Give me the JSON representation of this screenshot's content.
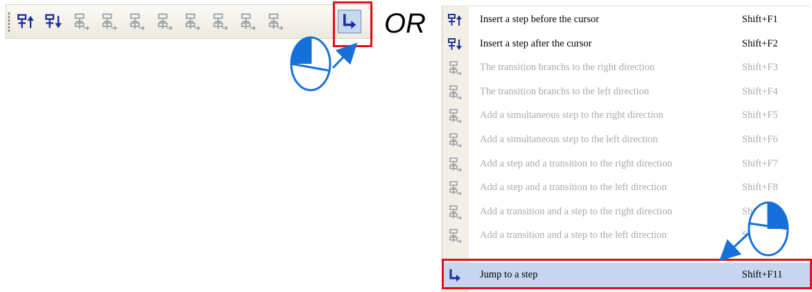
{
  "separator_text": "OR",
  "toolbar": {
    "buttons": [
      {
        "name": "insert-step-before-button",
        "icon": "step-insert-before-icon",
        "enabled": true
      },
      {
        "name": "insert-step-after-button",
        "icon": "step-insert-after-icon",
        "enabled": true
      },
      {
        "name": "transition-branch-right-button",
        "icon": "branch-right-icon",
        "enabled": false
      },
      {
        "name": "transition-branch-left-button",
        "icon": "branch-left-icon",
        "enabled": false
      },
      {
        "name": "simultaneous-step-right-button",
        "icon": "simultaneous-right-icon",
        "enabled": false
      },
      {
        "name": "simultaneous-step-left-button",
        "icon": "simultaneous-left-icon",
        "enabled": false
      },
      {
        "name": "step-transition-right-button",
        "icon": "step-transition-right-icon",
        "enabled": false
      },
      {
        "name": "step-transition-left-button",
        "icon": "step-transition-left-icon",
        "enabled": false
      },
      {
        "name": "transition-step-right-button",
        "icon": "transition-step-right-icon",
        "enabled": false
      },
      {
        "name": "transition-step-left-button",
        "icon": "transition-step-left-icon",
        "enabled": false
      },
      {
        "name": "jump-to-step-button",
        "icon": "jump-arrow-icon",
        "enabled": true,
        "highlighted": true
      }
    ]
  },
  "menu": {
    "items": [
      {
        "label": "Insert a step before the cursor",
        "shortcut": "Shift+F1",
        "enabled": true,
        "icon": "step-insert-before-icon"
      },
      {
        "label": "Insert a step after the cursor",
        "shortcut": "Shift+F2",
        "enabled": true,
        "icon": "step-insert-after-icon"
      },
      {
        "label": "The transition branchs to the right direction",
        "shortcut": "Shift+F3",
        "enabled": false,
        "icon": "branch-right-icon"
      },
      {
        "label": "The transition branchs to the left direction",
        "shortcut": "Shift+F4",
        "enabled": false,
        "icon": "branch-left-icon"
      },
      {
        "label": "Add a simultaneous step to the right direction",
        "shortcut": "Shift+F5",
        "enabled": false,
        "icon": "simultaneous-right-icon"
      },
      {
        "label": "Add a simultaneous step to the left direction",
        "shortcut": "Shift+F6",
        "enabled": false,
        "icon": "simultaneous-left-icon"
      },
      {
        "label": "Add a step and a transition to the right direction",
        "shortcut": "Shift+F7",
        "enabled": false,
        "icon": "step-transition-right-icon"
      },
      {
        "label": "Add a step and a transition to the left direction",
        "shortcut": "Shift+F8",
        "enabled": false,
        "icon": "step-transition-left-icon"
      },
      {
        "label": "Add a transition and a step to the right direction",
        "shortcut": "Shift+F9",
        "enabled": false,
        "icon": "transition-step-right-icon"
      },
      {
        "label": "Add a transition and a step to the left direction",
        "shortcut": "Shift+F10",
        "enabled": false,
        "icon": "transition-step-left-icon"
      },
      {
        "label": "Jump to a step",
        "shortcut": "Shift+F11",
        "enabled": true,
        "selected": true,
        "icon": "jump-arrow-icon"
      }
    ]
  },
  "colors": {
    "highlight_box": "#e0101a",
    "selection": "#c5d6ee",
    "icon_active": "#1b2f9c",
    "icon_disabled": "#9da3a6",
    "mouse_fill": "#1570d8"
  }
}
